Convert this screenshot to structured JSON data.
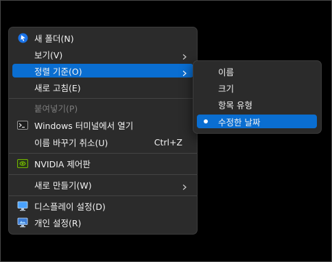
{
  "context_menu": {
    "items": {
      "new_folder": {
        "label": "새 폴더(N)"
      },
      "view": {
        "label": "보기(V)"
      },
      "sort_by": {
        "label": "정렬 기준(O)"
      },
      "refresh": {
        "label": "새로 고침(E)"
      },
      "paste": {
        "label": "붙여넣기(P)"
      },
      "open_terminal": {
        "label": "Windows 터미널에서 열기"
      },
      "undo_rename": {
        "label": "이름 바꾸기 취소(U)",
        "shortcut": "Ctrl+Z"
      },
      "nvidia": {
        "label": "NVIDIA 제어판"
      },
      "new": {
        "label": "새로 만들기(W)"
      },
      "display_settings": {
        "label": "디스플레이 설정(D)"
      },
      "personalize": {
        "label": "개인 설정(R)"
      }
    }
  },
  "sort_submenu": {
    "items": [
      {
        "label": "이름",
        "selected": false
      },
      {
        "label": "크기",
        "selected": false
      },
      {
        "label": "항목 유형",
        "selected": false
      },
      {
        "label": "수정한 날짜",
        "selected": true
      }
    ]
  },
  "colors": {
    "menu_bg": "#2b2b2b",
    "highlight": "#0a6ed1",
    "text": "#f2f2f2",
    "disabled_text": "#7c7c7c"
  }
}
